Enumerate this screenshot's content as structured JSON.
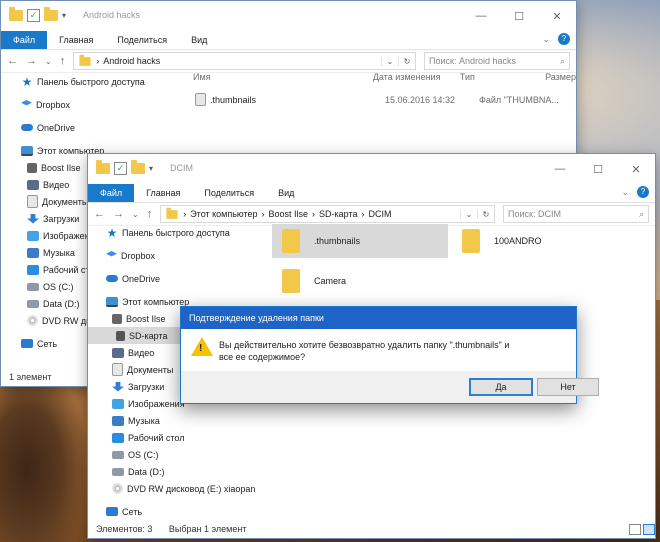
{
  "back_window": {
    "title": "Android hacks",
    "tabs": [
      "Файл",
      "Главная",
      "Поделиться",
      "Вид"
    ],
    "address": "Android hacks",
    "search_placeholder": "Поиск: Android hacks",
    "nav": [
      "Панель быстрого доступа",
      "Dropbox",
      "OneDrive",
      "Этот компьютер",
      "Boost Ilse",
      "Видео",
      "Документы",
      "Загрузки",
      "Изображения",
      "Музыка",
      "Рабочий стол",
      "OS (C:)",
      "Data (D:)",
      "DVD RW дисков",
      "Сеть"
    ],
    "columns": {
      "name": "Имя",
      "date": "Дата изменения",
      "type": "Тип",
      "size": "Размер"
    },
    "file": {
      "name": ".thumbnails",
      "date": "15.06.2016 14:32",
      "type": "Файл \"THUMBNA..."
    },
    "status": "1 элемент"
  },
  "front_window": {
    "title": "DCIM",
    "tabs": [
      "Файл",
      "Главная",
      "Поделиться",
      "Вид"
    ],
    "breadcrumb": [
      "Этот компьютер",
      "Boost Ilse",
      "SD-карта",
      "DCIM"
    ],
    "search_placeholder": "Поиск: DCIM",
    "nav": [
      "Панель быстрого доступа",
      "Dropbox",
      "OneDrive",
      "Этот компьютер",
      "Boost Ilse",
      "SD-карта",
      "Видео",
      "Документы",
      "Загрузки",
      "Изображения",
      "Музыка",
      "Рабочий стол",
      "OS (C:)",
      "Data (D:)",
      "DVD RW дисковод (E:) xiaopan",
      "Сеть"
    ],
    "folders": [
      ".thumbnails",
      "100ANDRO",
      "Camera"
    ],
    "status_count": "Элементов: 3",
    "status_selected": "Выбран 1 элемент"
  },
  "dialog": {
    "title": "Подтверждение удаления папки",
    "message": "Вы действительно хотите безвозвратно удалить папку \".thumbnails\" и все ее содержимое?",
    "yes": "Да",
    "no": "Нет"
  },
  "colors": {
    "accent": "#1979ca",
    "dialog_title": "#1e64c8",
    "folder": "#f3c84a",
    "selection": "#d9d9d9"
  }
}
